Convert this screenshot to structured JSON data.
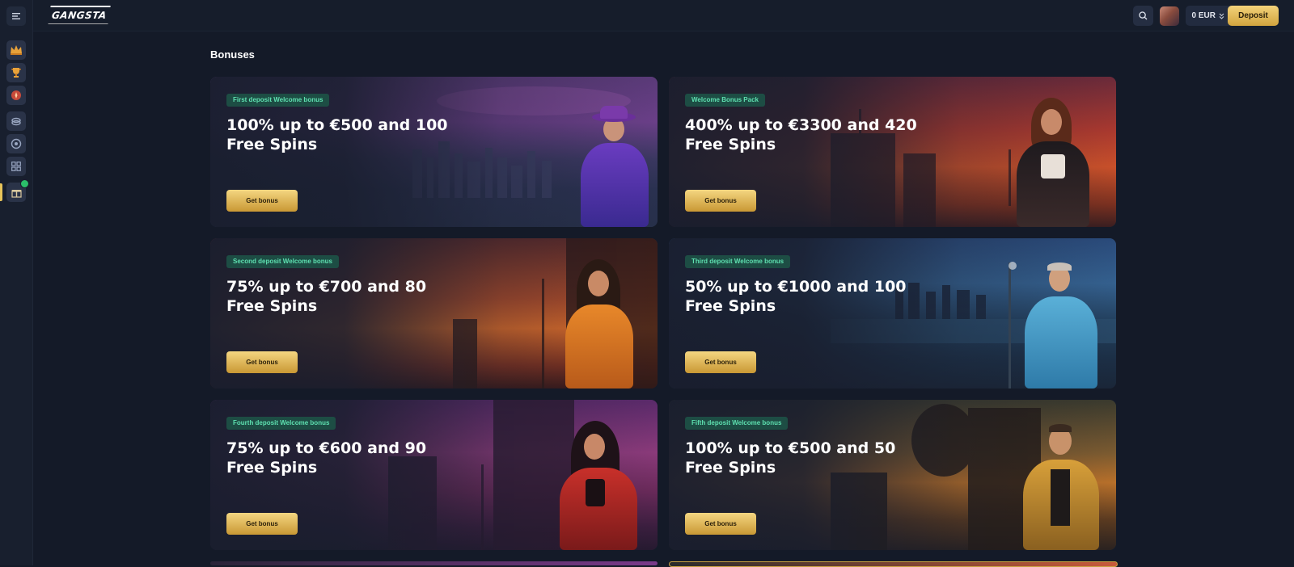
{
  "header": {
    "logo_text": "GANGSTA",
    "balance": "0 EUR",
    "deposit_label": "Deposit"
  },
  "page": {
    "title": "Bonuses"
  },
  "sidebar": {
    "items": [
      {
        "icon": "crown-icon"
      },
      {
        "icon": "trophy-icon"
      },
      {
        "icon": "compass-icon"
      },
      {
        "icon": "chips-icon"
      },
      {
        "icon": "roulette-icon"
      },
      {
        "icon": "grid-icon"
      },
      {
        "icon": "gift-icon",
        "active": true
      }
    ]
  },
  "bonuses": [
    {
      "tag": "First deposit Welcome bonus",
      "title": "100% up to €500 and 100 Free Spins",
      "button": "Get bonus"
    },
    {
      "tag": "Welcome Bonus Pack",
      "title": "400% up to €3300 and 420 Free Spins",
      "button": "Get bonus"
    },
    {
      "tag": "Second deposit Welcome bonus",
      "title": "75% up to €700 and 80 Free Spins",
      "button": "Get bonus"
    },
    {
      "tag": "Third deposit Welcome bonus",
      "title": "50% up to €1000 and 100 Free Spins",
      "button": "Get bonus"
    },
    {
      "tag": "Fourth deposit Welcome bonus",
      "title": "75% up to €600 and 90 Free Spins",
      "button": "Get bonus"
    },
    {
      "tag": "Fifth deposit Welcome bonus",
      "title": "100% up to €500 and 50 Free Spins",
      "button": "Get bonus"
    }
  ],
  "colors": {
    "accent_gold": "#e8c45a",
    "tag_green": "#5ee0b0",
    "background": "#141a28"
  }
}
